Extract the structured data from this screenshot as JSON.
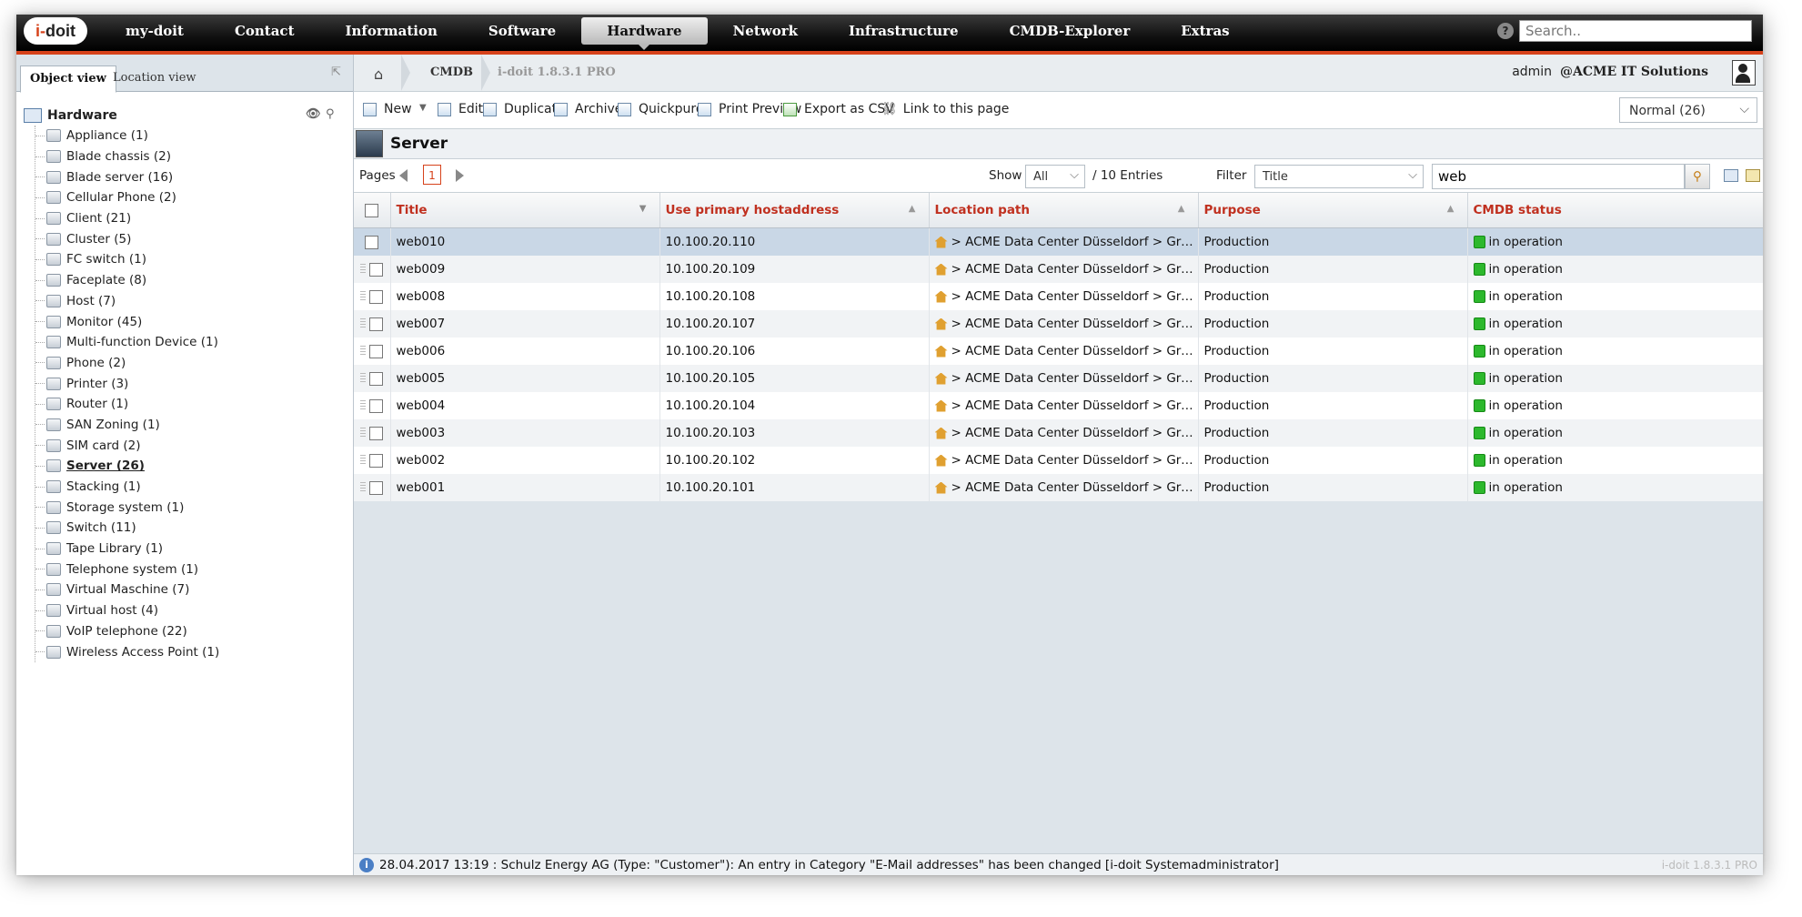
{
  "app": {
    "logo_text_a": "i-",
    "logo_text_b": "doit",
    "nav": [
      "my-doit",
      "Contact",
      "Information",
      "Software",
      "Hardware",
      "Network",
      "Infrastructure",
      "CMDB-Explorer",
      "Extras"
    ],
    "active_nav": "Hardware",
    "search_placeholder": "Search.."
  },
  "left": {
    "tabs": [
      "Object view",
      "Location view"
    ],
    "root": "Hardware",
    "items": [
      {
        "label": "Appliance (1)"
      },
      {
        "label": "Blade chassis (2)"
      },
      {
        "label": "Blade server (16)"
      },
      {
        "label": "Cellular Phone (2)"
      },
      {
        "label": "Client (21)"
      },
      {
        "label": "Cluster (5)"
      },
      {
        "label": "FC switch (1)"
      },
      {
        "label": "Faceplate (8)"
      },
      {
        "label": "Host (7)"
      },
      {
        "label": "Monitor (45)"
      },
      {
        "label": "Multi-function Device (1)"
      },
      {
        "label": "Phone (2)"
      },
      {
        "label": "Printer (3)"
      },
      {
        "label": "Router (1)"
      },
      {
        "label": "SAN Zoning (1)"
      },
      {
        "label": "SIM card (2)"
      },
      {
        "label": "Server (26)",
        "active": true
      },
      {
        "label": "Stacking (1)"
      },
      {
        "label": "Storage system (1)"
      },
      {
        "label": "Switch (11)"
      },
      {
        "label": "Tape Library (1)"
      },
      {
        "label": "Telephone system (1)"
      },
      {
        "label": "Virtual Maschine (7)"
      },
      {
        "label": "Virtual host (4)"
      },
      {
        "label": "VoIP telephone (22)"
      },
      {
        "label": "Wireless Access Point (1)"
      }
    ]
  },
  "breadcrumb": {
    "crumb1": "CMDB",
    "crumb2": "i-doit 1.8.3.1 PRO"
  },
  "user": {
    "name": "admin",
    "org": "@ACME IT Solutions"
  },
  "toolbar": {
    "new": "New",
    "edit": "Edit",
    "duplicate": "Duplicate",
    "archive": "Archive",
    "quickpurge": "Quickpurge",
    "print": "Print Preview",
    "export": "Export as CSV",
    "link": "Link to this page",
    "mode": "Normal (26)"
  },
  "page_title": "Server",
  "pager": {
    "pages_label": "Pages",
    "page": "1",
    "show_label": "Show",
    "show_value": "All",
    "entries": "/ 10 Entries",
    "filter_label": "Filter",
    "filter_field": "Title",
    "filter_value": "web"
  },
  "table": {
    "headers": [
      "Title",
      "Use primary hostaddress",
      "Location path",
      "Purpose",
      "CMDB status"
    ],
    "rows": [
      {
        "title": "web010",
        "ip": "10.100.20.110",
        "loc": "> ACME Data Center Düsseldorf > Groun...",
        "purpose": "Production",
        "status": "in operation"
      },
      {
        "title": "web009",
        "ip": "10.100.20.109",
        "loc": "> ACME Data Center Düsseldorf > Groun...",
        "purpose": "Production",
        "status": "in operation"
      },
      {
        "title": "web008",
        "ip": "10.100.20.108",
        "loc": "> ACME Data Center Düsseldorf > Groun...",
        "purpose": "Production",
        "status": "in operation"
      },
      {
        "title": "web007",
        "ip": "10.100.20.107",
        "loc": "> ACME Data Center Düsseldorf > Groun...",
        "purpose": "Production",
        "status": "in operation"
      },
      {
        "title": "web006",
        "ip": "10.100.20.106",
        "loc": "> ACME Data Center Düsseldorf > Groun...",
        "purpose": "Production",
        "status": "in operation"
      },
      {
        "title": "web005",
        "ip": "10.100.20.105",
        "loc": "> ACME Data Center Düsseldorf > Groun...",
        "purpose": "Production",
        "status": "in operation"
      },
      {
        "title": "web004",
        "ip": "10.100.20.104",
        "loc": "> ACME Data Center Düsseldorf > Groun...",
        "purpose": "Production",
        "status": "in operation"
      },
      {
        "title": "web003",
        "ip": "10.100.20.103",
        "loc": "> ACME Data Center Düsseldorf > Groun...",
        "purpose": "Production",
        "status": "in operation"
      },
      {
        "title": "web002",
        "ip": "10.100.20.102",
        "loc": "> ACME Data Center Düsseldorf > Groun...",
        "purpose": "Production",
        "status": "in operation"
      },
      {
        "title": "web001",
        "ip": "10.100.20.101",
        "loc": "> ACME Data Center Düsseldorf > Groun...",
        "purpose": "Production",
        "status": "in operation"
      }
    ]
  },
  "statusbar": {
    "message": "28.04.2017 13:19 : Schulz Energy AG (Type: \"Customer\"): An entry in Category \"E-Mail addresses\" has been changed [i-doit Systemadministrator]",
    "version": "i-doit 1.8.3.1 PRO"
  },
  "colors": {
    "accent": "#d6421b",
    "header_text": "#c0301f",
    "status_ok": "#2db82d"
  }
}
